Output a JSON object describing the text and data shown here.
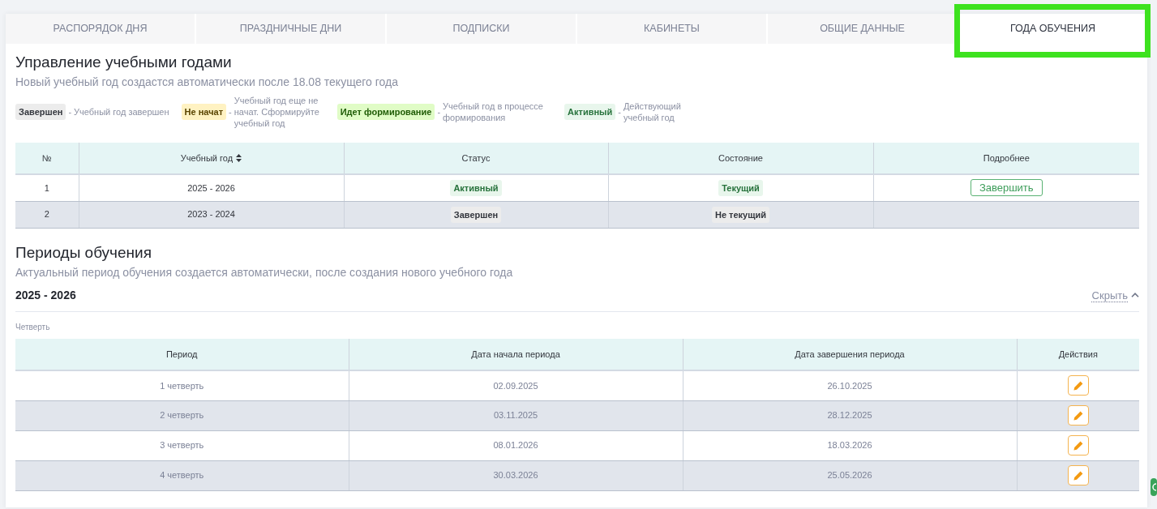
{
  "tabs": [
    {
      "label": "РАСПОРЯДОК ДНЯ",
      "selected": false,
      "highlighted": false
    },
    {
      "label": "ПРАЗДНИЧНЫЕ ДНИ",
      "selected": false,
      "highlighted": false
    },
    {
      "label": "ПОДПИСКИ",
      "selected": false,
      "highlighted": false
    },
    {
      "label": "КАБИНЕТЫ",
      "selected": false,
      "highlighted": false
    },
    {
      "label": "ОБЩИЕ ДАННЫЕ",
      "selected": false,
      "highlighted": false
    },
    {
      "label": "ГОДА ОБУЧЕНИЯ",
      "selected": true,
      "highlighted": true
    }
  ],
  "years_section": {
    "title": "Управление учебными годами",
    "subtitle": "Новый учебный год создастся автоматически после 18.08 текущего года",
    "legend": [
      {
        "tag": "Завершен",
        "kind": "done",
        "dash": "-",
        "description": "Учебный год завершен"
      },
      {
        "tag": "Не начат",
        "kind": "not_started",
        "dash": "-",
        "description": "Учебный год еще не начат. Сформируйте учебный год"
      },
      {
        "tag": "Идет формирование",
        "kind": "forming",
        "dash": "-",
        "description": "Учебный год в процессе формирования"
      },
      {
        "tag": "Активный",
        "kind": "active",
        "dash": "-",
        "description": "Действующий учебный год"
      }
    ],
    "table": {
      "columns": [
        {
          "label": "№",
          "sortable": false
        },
        {
          "label": "Учебный год",
          "sortable": true
        },
        {
          "label": "Статус",
          "sortable": false
        },
        {
          "label": "Состояние",
          "sortable": false
        },
        {
          "label": "Подробнее",
          "sortable": false
        }
      ],
      "rows": [
        {
          "number": "1",
          "year": "2025 - 2026",
          "status": {
            "text": "Активный",
            "kind": "active"
          },
          "state": {
            "text": "Текущий",
            "kind": "active"
          },
          "action": "Завершить"
        },
        {
          "number": "2",
          "year": "2023 - 2024",
          "status": {
            "text": "Завершен",
            "kind": "done"
          },
          "state": {
            "text": "Не текущий",
            "kind": "done"
          }
        }
      ]
    }
  },
  "periods_section": {
    "title": "Периоды обучения",
    "subtitle": "Актуальный период обучения создается автоматически, после создания нового учебного года",
    "year": "2025 - 2026",
    "toggle": "Скрыть",
    "expanded": true,
    "group_label": "Четверть",
    "table": {
      "columns": [
        "Период",
        "Дата начала периода",
        "Дата завершения периода",
        "Действия"
      ],
      "rows": [
        {
          "period": "1 четверть",
          "start": "02.09.2025",
          "end": "26.10.2025"
        },
        {
          "period": "2 четверть",
          "start": "03.11.2025",
          "end": "28.12.2025"
        },
        {
          "period": "3 четверть",
          "start": "08.01.2026",
          "end": "18.03.2026"
        },
        {
          "period": "4 четверть",
          "start": "30.03.2026",
          "end": "25.05.2026"
        }
      ]
    }
  }
}
